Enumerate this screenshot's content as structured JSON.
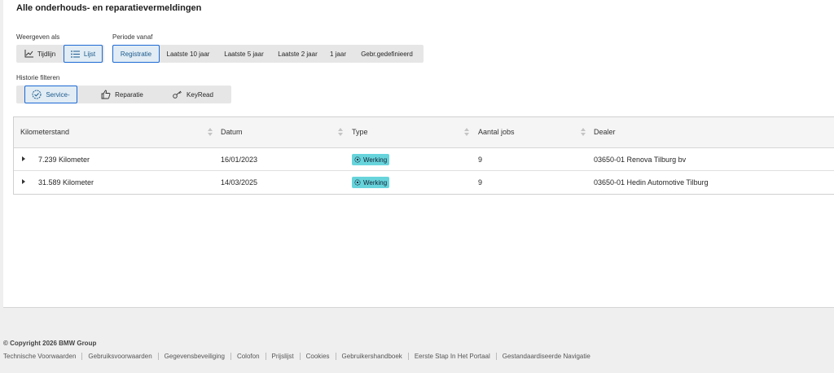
{
  "page": {
    "title": "Alle onderhouds- en reparatievermeldingen"
  },
  "view": {
    "label": "Weergeven als",
    "options": [
      {
        "label": "Tijdlijn",
        "icon": "chart-line-icon",
        "active": false
      },
      {
        "label": "Lijst",
        "icon": "list-icon",
        "active": true
      }
    ]
  },
  "period": {
    "label": "Periode vanaf",
    "options": [
      "Registratie",
      "Laatste 10 jaar",
      "Laatste 5 jaar",
      "Laatste 2 jaar",
      "1 jaar",
      "Gebr.gedefinieerd"
    ],
    "active": "Registratie"
  },
  "filter": {
    "label": "Historie filteren",
    "options": [
      {
        "label": "Service-",
        "icon": "service-gear-icon",
        "active": true
      },
      {
        "label": "Reparatie",
        "icon": "thumbs-up-icon",
        "active": false
      },
      {
        "label": "KeyRead",
        "icon": "key-icon",
        "active": false
      }
    ]
  },
  "table": {
    "columns": [
      "Kilometerstand",
      "Datum",
      "Type",
      "Aantal jobs",
      "Dealer"
    ],
    "rows": [
      {
        "km": "7.239 Kilometer",
        "date": "16/01/2023",
        "type": "Werking",
        "jobs": "9",
        "dealer": "03650-01 Renova Tilburg bv"
      },
      {
        "km": "31.589 Kilometer",
        "date": "14/03/2025",
        "type": "Werking",
        "jobs": "9",
        "dealer": "03650-01 Hedin Automotive Tilburg"
      }
    ]
  },
  "footer": {
    "copyright": "© Copyright 2026 BMW Group",
    "links": [
      "Technische Voorwaarden",
      "Gebruiksvoorwaarden",
      "Gegevensbeveiliging",
      "Colofon",
      "Prijslijst",
      "Cookies",
      "Gebruikershandboek",
      "Eerste Stap In Het Portaal",
      "Gestandaardiseerde Navigatie"
    ]
  },
  "colors": {
    "accent": "#1c69d4",
    "badge": "#67d4dc",
    "active_bg": "#e1ecf4"
  }
}
